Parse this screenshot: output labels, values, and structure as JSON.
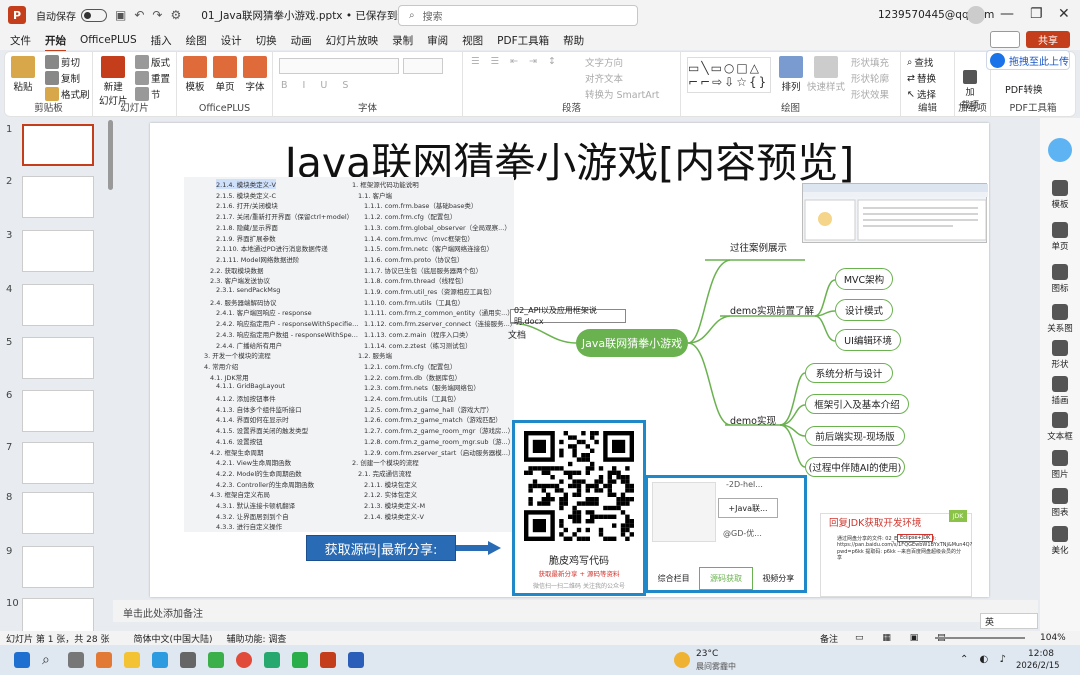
{
  "titlebar": {
    "autosave": "自动保存",
    "autosave_state": "关",
    "document": "01_Java联网猜拳小游戏.pptx • 已保存到这台电脑",
    "search_placeholder": "搜索",
    "account": "1239570445@qq.com"
  },
  "menu_tabs": [
    "文件",
    "开始",
    "OfficePLUS",
    "插入",
    "绘图",
    "设计",
    "切换",
    "动画",
    "幻灯片放映",
    "录制",
    "审阅",
    "视图",
    "PDF工具箱",
    "帮助"
  ],
  "share_label": "共享",
  "upload_label": "拖拽至此上传",
  "ribbon": {
    "clipboard": {
      "label": "剪贴板",
      "paste": "粘贴",
      "cut": "剪切",
      "copy": "复制",
      "format": "格式刷"
    },
    "slides": {
      "label": "幻灯片",
      "new": "新建\n幻灯片",
      "layout": "版式",
      "reset": "重置",
      "section": "节"
    },
    "officeplus": {
      "label": "OfficePLUS",
      "template": "模板",
      "single": "单页",
      "font": "字体"
    },
    "font_label": "字体",
    "paragraph": {
      "label": "段落",
      "text_dir": "文字方向",
      "align": "对齐文本",
      "smartart": "转换为 SmartArt"
    },
    "drawing": {
      "label": "绘图",
      "arrange": "排列",
      "quick": "快速样式",
      "fill": "形状填充",
      "outline": "形状轮廓",
      "effects": "形状效果"
    },
    "editing": {
      "label": "编辑",
      "find": "查找",
      "replace": "替换",
      "select": "选择"
    },
    "addins": {
      "label": "加载项",
      "btn": "加\n载项"
    },
    "pdf": {
      "label": "PDF工具箱",
      "btn": "PDF转换"
    }
  },
  "slide_numbers": [
    "1",
    "2",
    "3",
    "4",
    "5",
    "6",
    "7",
    "8",
    "9",
    "10"
  ],
  "slide": {
    "title": "Java联网猜拳小游戏[内容预览]",
    "toc_left": [
      "2.1.4. 模块类定义-V",
      "2.1.5. 模块类定义-C",
      "2.1.6. 打开/关闭模块",
      "2.1.7. 关闭/重新打开界面（保留ctrl+model）",
      "2.1.8. 隐藏/显示界面",
      "2.1.9. 界面扩展参数",
      "2.1.10. 本地通过PD进行消息数据传递",
      "2.1.11. Model网络数据进阶",
      "2.2. 获取模块数据",
      "2.3. 客户端发送协议",
      "2.3.1. sendPackMsg",
      "2.4. 服务器端解码协议",
      "2.4.1. 客户端回响应 - response",
      "2.4.2. 响应指定用户 - responseWithSpecifie...",
      "2.4.3. 响应指定用户数组 - responseWithSpe...",
      "2.4.4. 广播给所有用户",
      "3. 开发一个模块的流程",
      "4. 常用介绍",
      "4.1. JDK常用",
      "4.1.1. GridBagLayout",
      "4.1.2. 添加按钮事件",
      "4.1.3. 自体多个组件监听接口",
      "4.1.4. 界面如何在显示时",
      "4.1.5. 设置界面关闭的触发类型",
      "4.1.6. 设置按钮",
      "4.2. 框架生命周期",
      "4.2.1. View生命周期函数",
      "4.2.2. Model的生命周期函数",
      "4.2.3. Controller的生命周期函数",
      "4.3. 框架自定义布局",
      "4.3.1. 默认连接卡顿机翻译",
      "4.3.2. 让界面居到到个自",
      "4.3.3. 进行自定义操作"
    ],
    "toc_right": [
      "1. 框架源代码功能说明",
      "1.1. 客户端",
      "1.1.1. com.frm.base（基础base类）",
      "1.1.2. com.frm.cfg（配置包）",
      "1.1.3. com.frm.global_observer（全局观察...）",
      "1.1.4. com.frm.mvc（mvc框架包）",
      "1.1.5. com.frm.netc（客户端网络连接包）",
      "1.1.6. com.frm.proto（协议包）",
      "1.1.7. 协议已生包（底层服务器两个包）",
      "1.1.8. com.frm.thread（线程包）",
      "1.1.9. com.frm.util_res（资源相应工具包）",
      "1.1.10. com.frm.utils（工具包）",
      "1.1.11. com.frm.z_common_entity（通用实...）",
      "1.1.12. com.frm.zserver_connect（连接服务...）",
      "1.1.13. com.z.main（程序入口类）",
      "1.1.14. com.z.ztest（练习测试包）",
      "1.2. 服务端",
      "1.2.1. com.frm.cfg（配置包）",
      "1.2.2. com.frm.db（数据库包）",
      "1.2.3. com.frm.nets（服务端网络包）",
      "1.2.4. com.frm.utils（工具包）",
      "1.2.5. com.frm.z_game_hall（游戏大厅）",
      "1.2.6. com.frm.z_game_match（游戏匹配）",
      "1.2.7. com.frm.z_game_room_mgr（游戏房...）",
      "1.2.8. com.frm.z_game_room_mgr.sub（游...）",
      "1.2.9. com.frm.zserver_start（启动服务器模...）",
      "2. 创建一个模块的流程",
      "2.1. 完成通信流程",
      "2.1.1. 模块包定义",
      "2.1.2. 实体包定义",
      "2.1.3. 模块类定义-M",
      "2.1.4. 模块类定义-V"
    ],
    "mind": {
      "center": "Java联网猜拳小游戏",
      "branch_review": "过往案例展示",
      "branch_prep": "demo实现前置了解",
      "branch_impl": "demo实现",
      "prep_items": [
        "MVC架构",
        "设计模式",
        "UI编辑环境"
      ],
      "impl_items": [
        "系统分析与设计",
        "框架引入及基本介绍",
        "前后端实现-现场版",
        "(过程中伴随AI的使用)"
      ],
      "docx": "02_API以及应用框架说明.docx",
      "doc_label": "文档"
    },
    "qr": {
      "title": "脆皮鸡写代码",
      "subtitle": "获取最新分享 + 源码等资料",
      "footer": "微信扫一扫二维码   关注我的公众号"
    },
    "get_source": "获取源码|最新分享:",
    "mini_app": {
      "top": "-2D-hel...",
      "mid": "+Java联...",
      "lower": "@GD-优...",
      "tabs": [
        "综合栏目",
        "源码获取",
        "视频分享"
      ]
    },
    "jdk": {
      "title": "回复JDK获取开发环境",
      "badge": "JDK",
      "text": "通过网盘分享的文件: 02_Eclipse+JDK链接: https://pan.baidu.com/s/1FQGEwbW1BYxTNj&Mun4Q?pwd=p6kk 提取码: p6kk --来自百度网盘超级会员的分享",
      "highlight": "Eclipse+JDK"
    }
  },
  "notes_placeholder": "单击此处添加备注",
  "status": {
    "slide_info": "幻灯片 第 1 张，共 28 张",
    "lang": "简体中文(中国大陆)",
    "accessibility": "辅助功能: 调查",
    "notes_btn": "备注",
    "zoom": "104%"
  },
  "rightbar": [
    "模板",
    "单页",
    "图标",
    "关系图",
    "形状",
    "插画",
    "文本框",
    "图片",
    "图表",
    "美化"
  ],
  "taskbar": {
    "weather_temp": "23°C",
    "weather_desc": "晨间雾霾中",
    "time": "12:08",
    "date": "2026/2/15",
    "ime": "英"
  }
}
